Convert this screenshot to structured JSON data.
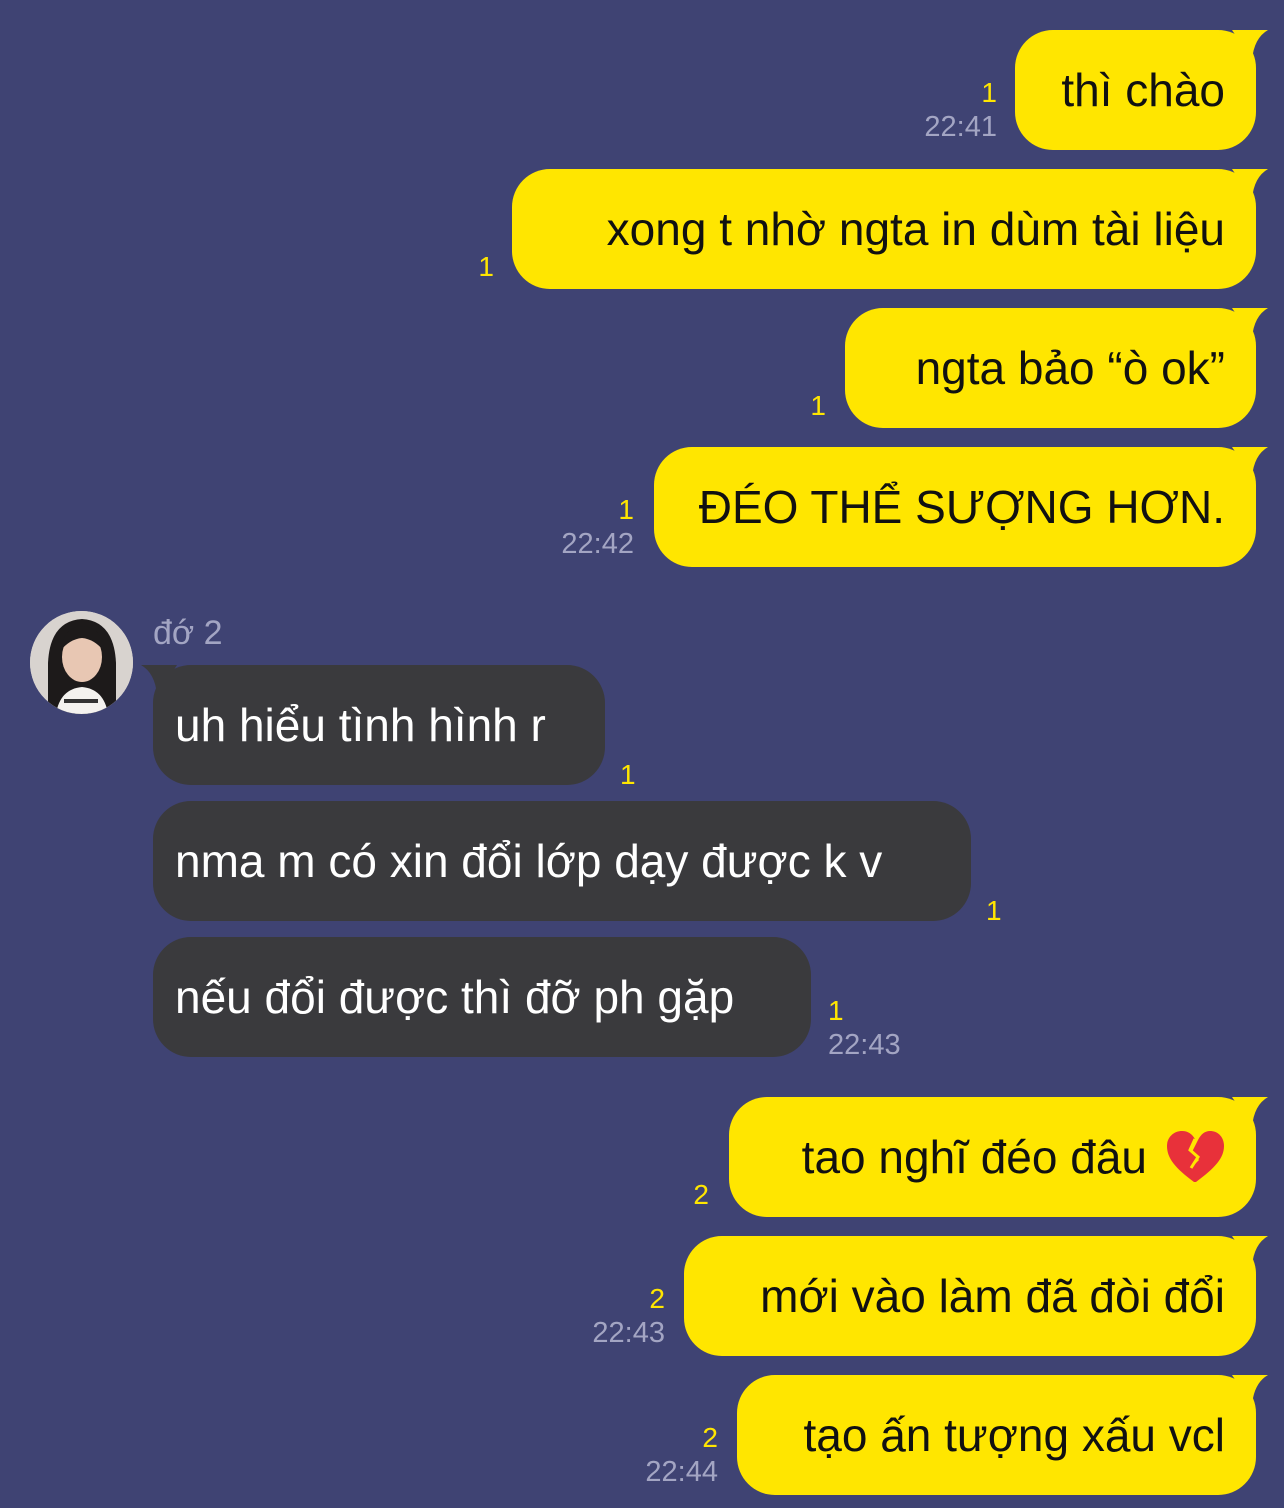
{
  "colors": {
    "background": "#3f4373",
    "outgoing_bubble": "#ffe600",
    "incoming_bubble": "#3a3a3d",
    "unread": "#ffe600",
    "timestamp": "#a3a5c3"
  },
  "outgoing_1": {
    "messages": [
      {
        "text": "thì chào",
        "unread": "1",
        "time": "22:41"
      },
      {
        "text": "xong t nhờ ngta in dùm tài liệu",
        "unread": "1"
      },
      {
        "text": "ngta bảo “ò ok”",
        "unread": "1"
      },
      {
        "text": "ĐÉO THỂ SƯỢNG HƠN.",
        "unread": "1",
        "time": "22:42"
      }
    ]
  },
  "incoming": {
    "sender_name": "đớ 2",
    "avatar_icon": "profile-photo",
    "messages": [
      {
        "text": "uh hiểu tình hình r",
        "unread": "1"
      },
      {
        "text": "nma m có xin đổi lớp dạy được k v",
        "unread": "1"
      },
      {
        "text": "nếu đổi được thì đỡ ph gặp",
        "unread": "1",
        "time": "22:43"
      }
    ]
  },
  "outgoing_2": {
    "messages": [
      {
        "text": "tao nghĩ đéo đâu",
        "emoji": "broken-heart-icon",
        "unread": "2"
      },
      {
        "text": "mới vào làm đã đòi đổi",
        "unread": "2",
        "time": "22:43"
      },
      {
        "text": "tạo ấn tượng xấu vcl",
        "unread": "2",
        "time": "22:44"
      }
    ]
  }
}
